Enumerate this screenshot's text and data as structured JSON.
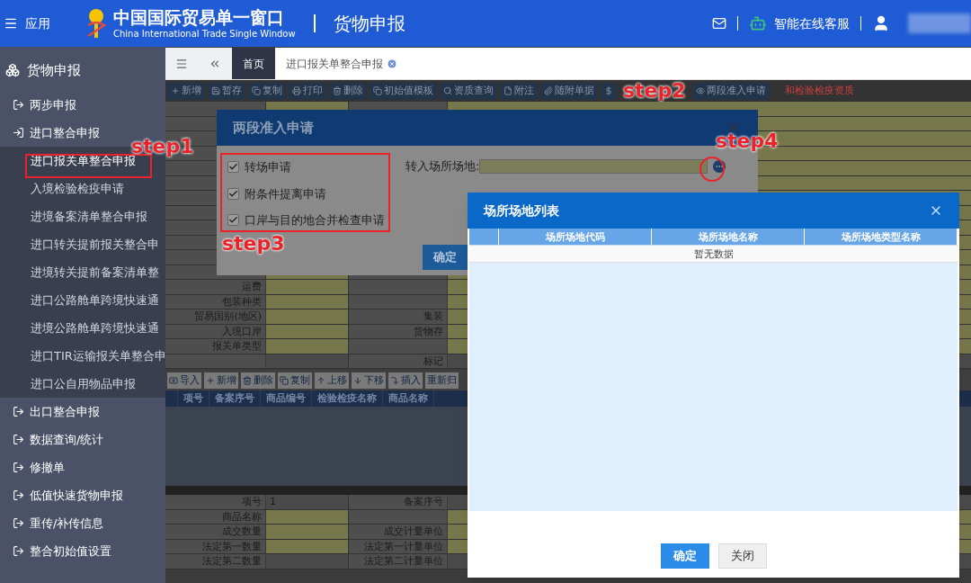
{
  "header": {
    "menu_label": "应用",
    "logo_title": "中国国际贸易单一窗口",
    "logo_subtitle": "China International Trade Single Window",
    "page_title": "货物申报",
    "support_label": "智能在线客服"
  },
  "sidebar": {
    "title": "货物申报",
    "items": [
      {
        "label": "两步申报",
        "expanded": false
      },
      {
        "label": "进口整合申报",
        "expanded": true,
        "children": [
          {
            "label": "进口报关单整合申报",
            "selected": true
          },
          {
            "label": "入境检验检疫申请",
            "selected": false
          },
          {
            "label": "进境备案清单整合申报",
            "selected": false
          },
          {
            "label": "进口转关提前报关整合申",
            "selected": false
          },
          {
            "label": "进境转关提前备案清单整",
            "selected": false
          },
          {
            "label": "进口公路舱单跨境快速通",
            "selected": false
          },
          {
            "label": "进境公路舱单跨境快速通",
            "selected": false
          },
          {
            "label": "进口TIR运输报关单整合申",
            "selected": false
          },
          {
            "label": "进口公自用物品申报",
            "selected": false
          }
        ]
      },
      {
        "label": "出口整合申报",
        "expanded": false
      },
      {
        "label": "数据查询/统计",
        "expanded": false
      },
      {
        "label": "修撤单",
        "expanded": false
      },
      {
        "label": "低值快速货物申报",
        "expanded": false
      },
      {
        "label": "重传/补传信息",
        "expanded": false
      },
      {
        "label": "整合初始值设置",
        "expanded": false
      }
    ]
  },
  "tabs": [
    {
      "label": "首页",
      "selected": true
    },
    {
      "label": "进口报关单整合申报",
      "selected": false
    }
  ],
  "toolbar": {
    "buttons": [
      {
        "label": "新增"
      },
      {
        "label": "暂存"
      },
      {
        "label": "复制"
      },
      {
        "label": "打印"
      },
      {
        "label": "删除"
      },
      {
        "label": "初始值模板"
      },
      {
        "label": "资质查询"
      },
      {
        "label": "附注"
      },
      {
        "label": "随附单据",
        "kind": "text"
      },
      {
        "kind": "icon"
      },
      {
        "label": "两段准入申请",
        "kind": "text"
      }
    ],
    "notice": "和检验检疫资质"
  },
  "form": {
    "rows": [
      {
        "label": "运费",
        "required": true
      },
      {
        "label": "包装种类",
        "required": true
      },
      {
        "label": "贸易国别(地区)",
        "required": true,
        "label2": "集装"
      },
      {
        "label": "入境口岸",
        "required": true,
        "label2": "货物存"
      },
      {
        "label": "报关单类型",
        "required": true
      },
      {
        "label2": "标记",
        "required": false
      }
    ]
  },
  "goods_toolbar": {
    "buttons": [
      "导入",
      "新增",
      "删除",
      "复制",
      "上移",
      "下移",
      "插入",
      "重新归"
    ]
  },
  "goods_table": {
    "columns": [
      "项号",
      "备案序号",
      "商品编号",
      "检验检疫名称",
      "商品名称"
    ]
  },
  "goods_form": {
    "rows": [
      {
        "label": "项号",
        "value": "1",
        "label2": "备案序号",
        "required": false
      },
      {
        "label": "商品名称",
        "required": true
      },
      {
        "label": "成交数量",
        "label2": "成交计量单位",
        "required": true
      },
      {
        "label": "法定第一数量",
        "label2": "法定第一计量单位",
        "required": true
      },
      {
        "label": "法定第二数量",
        "label2": "法定第二计量单位",
        "required": false
      }
    ]
  },
  "entry_dialog": {
    "title": "两段准入申请",
    "options": [
      {
        "label": "转场申请",
        "checked": true
      },
      {
        "label": "附条件提离申请",
        "checked": true
      },
      {
        "label": "口岸与目的地合并检查申请",
        "checked": true
      }
    ],
    "field_label": "转入场所场地:",
    "confirm": "确定"
  },
  "site_dialog": {
    "title": "场所场地列表",
    "columns": [
      "场所场地代码",
      "场所场地名称",
      "场所场地类型名称"
    ],
    "empty_text": "暂无数据",
    "confirm": "确定",
    "close": "关闭"
  },
  "annotations": [
    {
      "label": "step1"
    },
    {
      "label": "step2"
    },
    {
      "label": "step3"
    },
    {
      "label": "step4"
    }
  ]
}
